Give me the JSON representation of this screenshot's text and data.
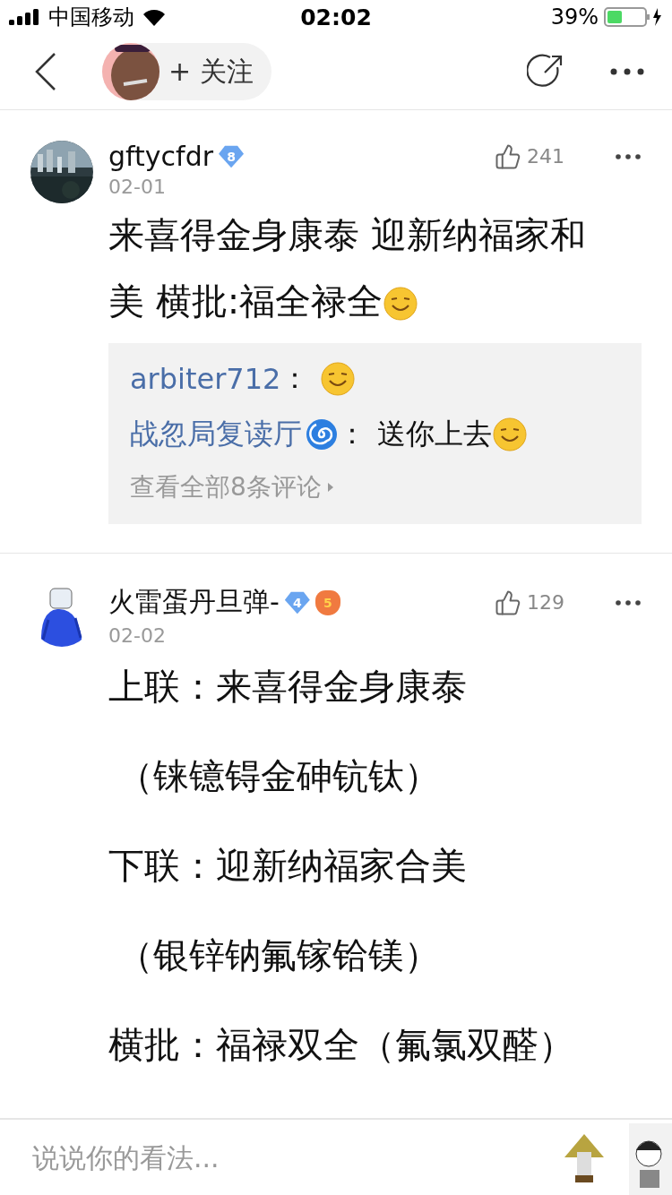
{
  "status_bar": {
    "carrier": "中国移动",
    "time": "02:02",
    "battery": "39%"
  },
  "nav": {
    "follow": "+ 关注"
  },
  "comments": [
    {
      "user": "gftycfdr",
      "badges": [
        {
          "kind": "level",
          "text": "8"
        }
      ],
      "date": "02-01",
      "likes": "241",
      "body": [
        "来喜得金身康泰 迎新纳福家和",
        "美 横批:福全禄全"
      ],
      "body_emoji": true,
      "replies": [
        {
          "user": "arbiter712",
          "user_icon": false,
          "sep": "：",
          "emoji": true
        },
        {
          "user": "战忽局复读厅",
          "user_icon": true,
          "sep": "：",
          "text": "送你上去",
          "emoji": true
        }
      ],
      "more": "查看全部8条评论"
    },
    {
      "user": "火雷蛋丹旦弹-",
      "badges": [
        {
          "kind": "level",
          "text": "4"
        },
        {
          "kind": "game",
          "text": "5"
        }
      ],
      "date": "02-02",
      "likes": "129",
      "body": [
        "上联：来喜得金身康泰",
        "（铼镱锝金砷钪钛）",
        "下联：迎新纳福家合美",
        "（银锌钠氟镓铪镁）",
        "横批：福禄双全（氟氯双醛）"
      ],
      "body_emoji": false
    }
  ],
  "composer": {
    "placeholder": "说说你的看法..."
  }
}
